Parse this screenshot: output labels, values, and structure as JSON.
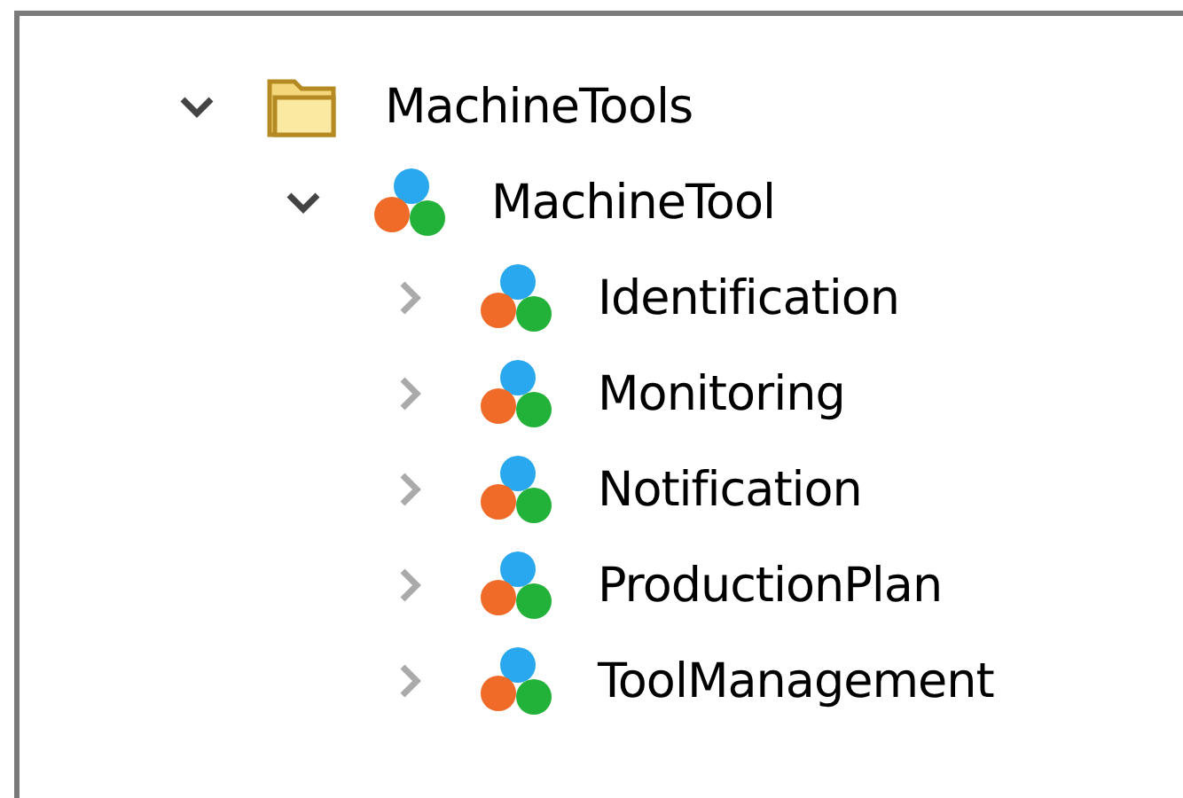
{
  "tree": [
    {
      "label": "MachineTools",
      "kind": "folder",
      "expanded": true,
      "children": [
        {
          "label": "MachineTool",
          "kind": "object",
          "expanded": true,
          "children": [
            {
              "label": "Identification",
              "kind": "object",
              "expanded": false
            },
            {
              "label": "Monitoring",
              "kind": "object",
              "expanded": false
            },
            {
              "label": "Notification",
              "kind": "object",
              "expanded": false
            },
            {
              "label": "ProductionPlan",
              "kind": "object",
              "expanded": false
            },
            {
              "label": "ToolManagement",
              "kind": "object",
              "expanded": false
            }
          ]
        }
      ]
    }
  ]
}
